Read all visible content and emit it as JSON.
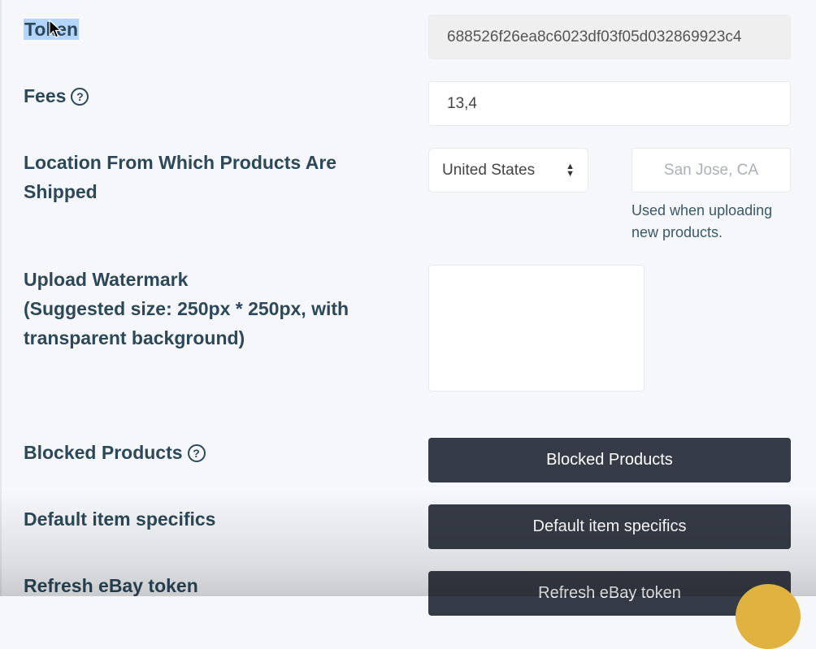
{
  "token": {
    "label": "Token",
    "value": "688526f26ea8c6023df03f05d032869923c4"
  },
  "fees": {
    "label": "Fees",
    "help_icon": "question-circle-icon",
    "value": "13,4"
  },
  "location": {
    "label": "Location From Which Products Are Shipped",
    "country_selected": "United States",
    "city_placeholder": "San Jose, CA",
    "help_text": "Used when uploading new products."
  },
  "watermark": {
    "label_line1": "Upload Watermark",
    "label_line2": "(Suggested size: 250px * 250px, with transparent background)"
  },
  "blocked_products": {
    "label": "Blocked Products",
    "help_icon": "question-circle-icon",
    "button_label": "Blocked Products"
  },
  "item_specifics": {
    "label": "Default item specifics",
    "button_label": "Default item specifics"
  },
  "refresh_token": {
    "label": "Refresh eBay token",
    "button_label": "Refresh eBay token"
  },
  "colors": {
    "background": "#f5f7fa",
    "label_text": "#2d4858",
    "button_bg": "#363c47",
    "button_text": "#ffffff",
    "selection_highlight": "#b3d4fc",
    "chat_bubble": "#e0b240"
  }
}
